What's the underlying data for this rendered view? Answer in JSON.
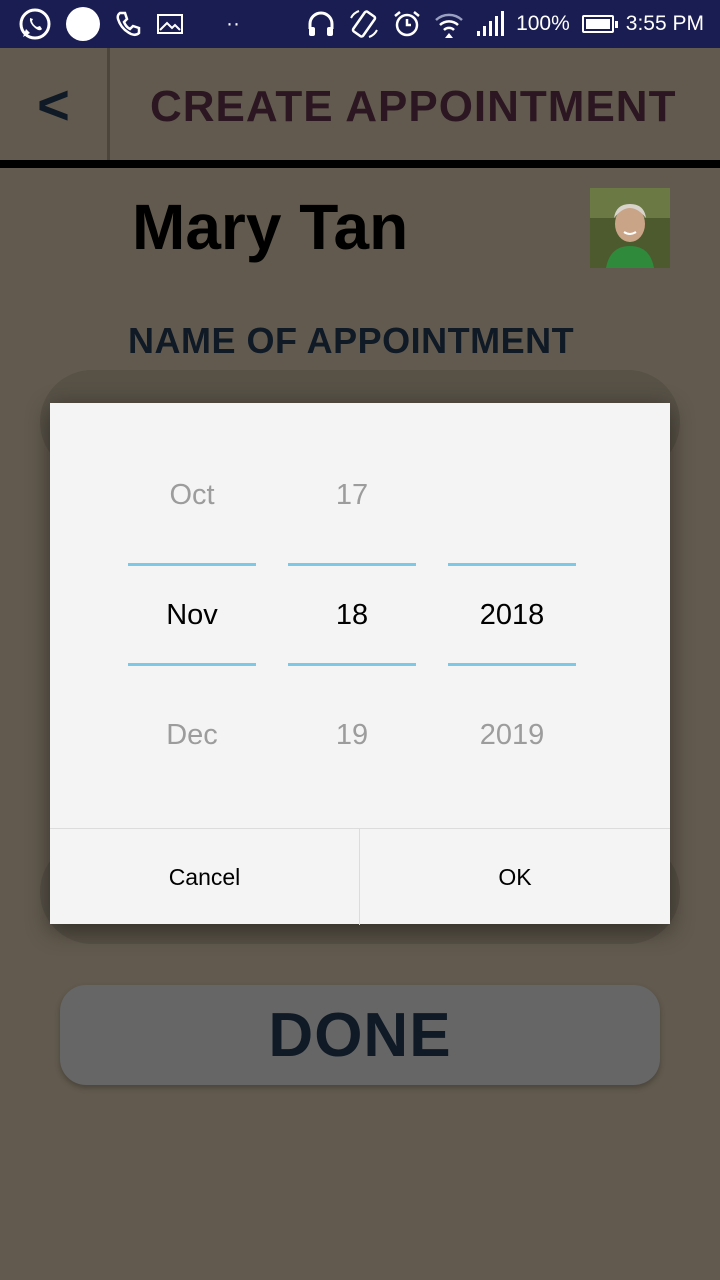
{
  "status_bar": {
    "battery": "100%",
    "time": "3:55 PM",
    "dots": "··",
    "icons": [
      "whatsapp-icon",
      "circle-notification-icon",
      "phone-icon",
      "gallery-icon",
      "headphones-icon",
      "rotation-icon",
      "alarm-icon",
      "wifi-icon",
      "signal-icon",
      "battery-icon"
    ]
  },
  "header": {
    "back_label": "<",
    "title": "CREATE APPOINTMENT"
  },
  "patient": {
    "name": "Mary Tan"
  },
  "form": {
    "name_label": "NAME OF APPOINTMENT",
    "done_label": "DONE"
  },
  "date_picker": {
    "month": {
      "prev": "Oct",
      "current": "Nov",
      "next": "Dec"
    },
    "day": {
      "prev": "17",
      "current": "18",
      "next": "19"
    },
    "year": {
      "prev": "",
      "current": "2018",
      "next": "2019"
    },
    "cancel_label": "Cancel",
    "ok_label": "OK",
    "divider_color": "#7cc8e6"
  },
  "colors": {
    "status_bar_bg": "#1a1d52",
    "dim_background": "#625a4e",
    "dialog_bg": "#f4f4f4"
  }
}
